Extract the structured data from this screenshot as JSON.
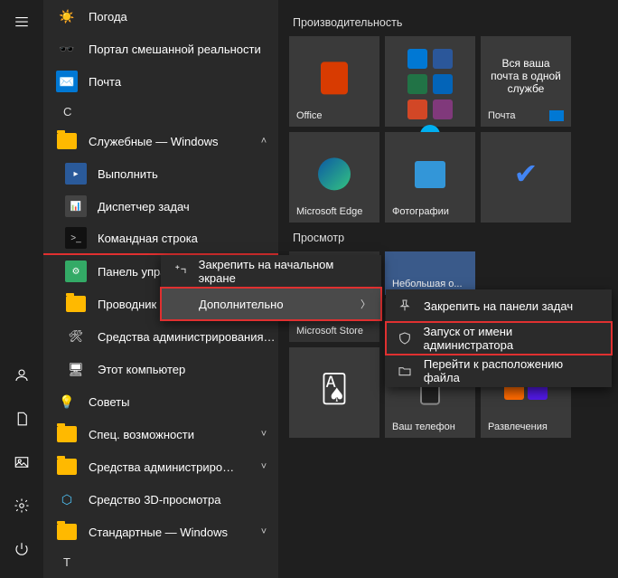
{
  "rail": {
    "menu": "menu",
    "user": "user",
    "documents": "documents",
    "pictures": "pictures",
    "settings": "settings",
    "power": "power"
  },
  "apps": {
    "weather": "Погода",
    "mixed_reality": "Портал смешанной реальности",
    "mail": "Почта",
    "letter_c": "С",
    "system_tools": "Служебные — Windows",
    "run": "Выполнить",
    "task_manager": "Диспетчер задач",
    "cmd": "Командная строка",
    "control_panel": "Панель управ",
    "explorer": "Проводник",
    "admin_tools": "Средства администрирования Win...",
    "this_pc": "Этот компьютер",
    "tips": "Советы",
    "accessibility": "Спец. возможности",
    "admin_tools2": "Средства администрирования W...",
    "viewer3d": "Средство 3D-просмотра",
    "std_windows": "Стандартные — Windows",
    "letter_t": "Т"
  },
  "tiles": {
    "group1": "Производительность",
    "office": "Office",
    "mail_tile": "Почта",
    "mail_text": "Вся ваша почта в одной службе",
    "edge": "Microsoft Edge",
    "photos": "Фотографии",
    "group2": "Просмотр",
    "small_window": "Небольшая о...",
    "store": "Microsoft Store",
    "your_phone": "Ваш телефон",
    "entertainment": "Развлечения"
  },
  "ctx1": {
    "pin": "Закрепить на начальном экране",
    "more": "Дополнительно"
  },
  "ctx2": {
    "pin_taskbar": "Закрепить на панели задач",
    "run_admin": "Запуск от имени администратора",
    "file_location": "Перейти к расположению файла"
  }
}
